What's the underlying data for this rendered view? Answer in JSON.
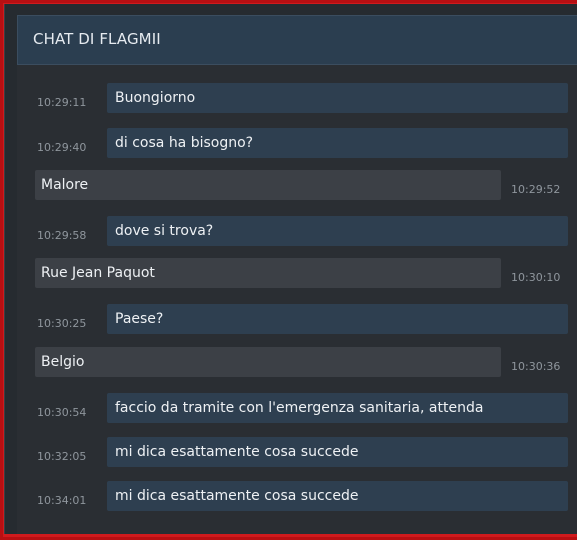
{
  "chat": {
    "title": "CHAT DI FLAGMII",
    "messages": [
      {
        "sender": "operator",
        "time": "10:29:11",
        "text": "Buongiorno"
      },
      {
        "sender": "operator",
        "time": "10:29:40",
        "text": "di cosa ha bisogno?"
      },
      {
        "sender": "user",
        "time": "10:29:52",
        "text": "Malore"
      },
      {
        "sender": "operator",
        "time": "10:29:58",
        "text": "dove si trova?"
      },
      {
        "sender": "user",
        "time": "10:30:10",
        "text": "Rue Jean Paquot"
      },
      {
        "sender": "operator",
        "time": "10:30:25",
        "text": "Paese?"
      },
      {
        "sender": "user",
        "time": "10:30:36",
        "text": "Belgio"
      },
      {
        "sender": "operator",
        "time": "10:30:54",
        "text": "faccio da tramite con l'emergenza sanitaria, attenda"
      },
      {
        "sender": "operator",
        "time": "10:32:05",
        "text": "mi dica esattamente cosa succede"
      },
      {
        "sender": "operator",
        "time": "10:34:01",
        "text": "mi dica esattamente cosa succede"
      }
    ]
  },
  "colors": {
    "frame_border": "#d01a1d",
    "header_bg": "#2b3e50",
    "operator_bubble": "#2e3f50",
    "user_bubble": "#3c4046",
    "panel_bg": "#2a2e33"
  }
}
